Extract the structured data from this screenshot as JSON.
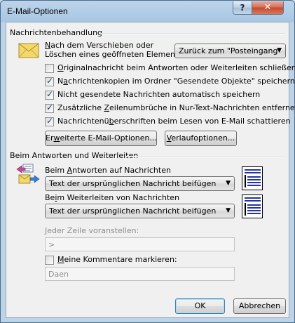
{
  "window": {
    "title": "E-Mail-Optionen",
    "help_glyph": "?",
    "close_glyph": "✕"
  },
  "message_handling": {
    "section_title": "Nachrichtenbehandlung",
    "move_label_line1": "Nach dem Verschieben oder",
    "move_label_line1_accel": "N",
    "move_label_line1_rest": "ach dem Verschieben oder",
    "move_label_line2": "Löschen eines geöffneten Elements:",
    "move_select_value": "Zurück zum \"Posteingang\"",
    "options": [
      {
        "accel": "O",
        "rest": "riginalnachricht beim Antworten oder Weiterleiten schließen",
        "checked": false
      },
      {
        "accel": "",
        "pre": "N",
        "accel_mid": "a",
        "rest": "chrichtenkopien im Ordner \"Gesendete Objekte\" speichern",
        "checked": true
      },
      {
        "pre": "Nicht ",
        "accel_mid": "g",
        "rest": "esendete Nachrichten automatisch speichern",
        "checked": true
      },
      {
        "pre": "Zusätzliche ",
        "accel_mid": "Z",
        "rest": "eilenumbrüche in Nur-Text-Nachrichten entfernen",
        "checked": true
      },
      {
        "pre": "Nachrichtenü",
        "accel_mid": "b",
        "rest": "erschriften beim Lesen von E-Mail schattieren",
        "checked": true
      }
    ],
    "advanced_button_pre": "Er",
    "advanced_button_accel": "w",
    "advanced_button_rest": "eiterte E-Mail-Optionen...",
    "tracking_button_accel": "V",
    "tracking_button_rest": "erlaufoptionen..."
  },
  "reply_forward": {
    "section_title": "Beim Antworten und Weiterleiten",
    "reply_label_pre": "Beim ",
    "reply_label_accel": "A",
    "reply_label_rest": "ntworten auf Nachrichten",
    "reply_select_value": "Text der ursprünglichen Nachricht beifügen",
    "forward_label_pre": "Be",
    "forward_label_accel": "i",
    "forward_label_rest": "m Weiterleiten von Nachrichten",
    "forward_select_value": "Text der ursprünglichen Nachricht beifügen",
    "prefix_label_accel": "J",
    "prefix_label_rest": "eder Zeile voranstellen:",
    "prefix_value": ">",
    "mark_comments_accel": "M",
    "mark_comments_rest": "eine Kommentare markieren:",
    "mark_comments_checked": false,
    "comment_name_value": "Daen"
  },
  "buttons": {
    "ok": "OK",
    "cancel": "Abbrechen"
  },
  "colors": {
    "envelope": "#f4d86a",
    "preview_line": "#2233aa",
    "close_button": "#c44a2f"
  },
  "icons": [
    "envelope-icon",
    "reply-forward-icon",
    "reply-preview-icon",
    "forward-preview-icon",
    "chevron-down-icon",
    "help-icon",
    "close-icon"
  ]
}
